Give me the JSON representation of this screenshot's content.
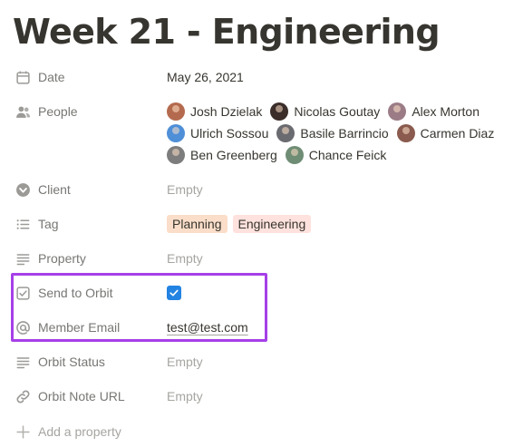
{
  "page": {
    "title": "Week 21 - Engineering"
  },
  "colors": {
    "highlight_border": "#a640e8",
    "checkbox_fill": "#2383e2"
  },
  "properties": {
    "date": {
      "label": "Date",
      "icon": "calendar-icon",
      "value": "May 26, 2021"
    },
    "people": {
      "label": "People",
      "icon": "people-icon",
      "persons": [
        {
          "name": "Josh Dzielak",
          "avatar_color": "#b46a4e"
        },
        {
          "name": "Nicolas Goutay",
          "avatar_color": "#3a2d2a"
        },
        {
          "name": "Alex Morton",
          "avatar_color": "#9b7c86"
        },
        {
          "name": "Ulrich Sossou",
          "avatar_color": "#4f8fd8"
        },
        {
          "name": "Basile Barrincio",
          "avatar_color": "#6a6b70"
        },
        {
          "name": "Carmen Diaz",
          "avatar_color": "#8a5b4e"
        },
        {
          "name": "Ben Greenberg",
          "avatar_color": "#7d7d7d"
        },
        {
          "name": "Chance Feick",
          "avatar_color": "#6f8d74"
        }
      ]
    },
    "client": {
      "label": "Client",
      "icon": "chevron-circle-icon",
      "value": "Empty"
    },
    "tag": {
      "label": "Tag",
      "icon": "list-icon",
      "tags": [
        {
          "label": "Planning",
          "color": "#fadec9"
        },
        {
          "label": "Engineering",
          "color": "#ffe2dd"
        }
      ]
    },
    "property": {
      "label": "Property",
      "icon": "text-icon",
      "value": "Empty"
    },
    "send_to_orbit": {
      "label": "Send to Orbit",
      "icon": "checkbox-icon",
      "checked": true
    },
    "member_email": {
      "label": "Member Email",
      "icon": "at-sign-icon",
      "value": "test@test.com"
    },
    "orbit_status": {
      "label": "Orbit Status",
      "icon": "text-icon",
      "value": "Empty"
    },
    "orbit_note_url": {
      "label": "Orbit Note URL",
      "icon": "link-icon",
      "value": "Empty"
    }
  },
  "add_property": {
    "label": "Add a property",
    "icon": "plus-icon"
  }
}
